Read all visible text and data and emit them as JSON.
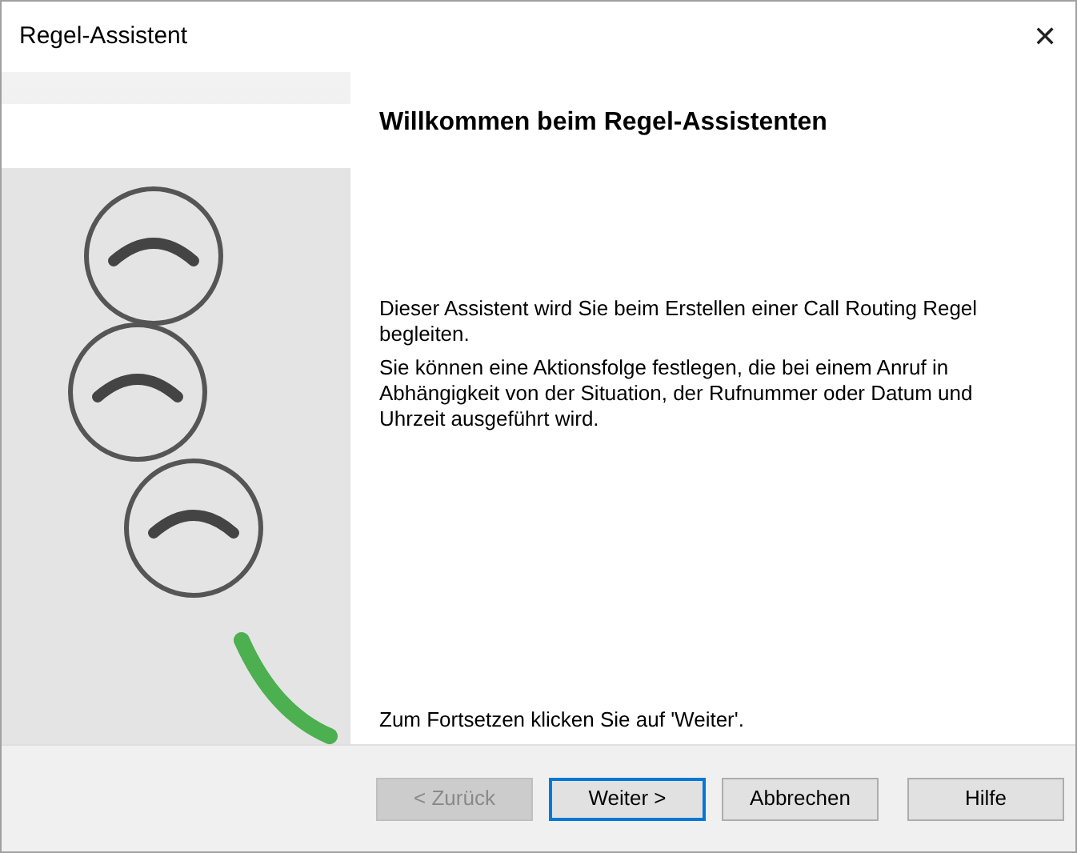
{
  "window": {
    "title": "Regel-Assistent",
    "close_glyph": "✕"
  },
  "heading": "Willkommen beim Regel-Assistenten",
  "paragraphs": [
    "Dieser Assistent wird Sie beim Erstellen einer Call Routing Regel begleiten.",
    "Sie können eine Aktionsfolge festlegen, die bei einem Anruf in Abhängigkeit von der Situation, der Rufnummer oder Datum und Uhrzeit ausgeführt wird."
  ],
  "footer_text": "Zum Fortsetzen klicken Sie auf 'Weiter'.",
  "buttons": [
    {
      "label": "< Zurück",
      "disabled": true,
      "default": false
    },
    {
      "label": "Weiter >",
      "disabled": false,
      "default": true
    },
    {
      "label": "Abbrechen",
      "disabled": false,
      "default": false
    },
    {
      "label": "Hilfe",
      "disabled": false,
      "default": false
    }
  ]
}
